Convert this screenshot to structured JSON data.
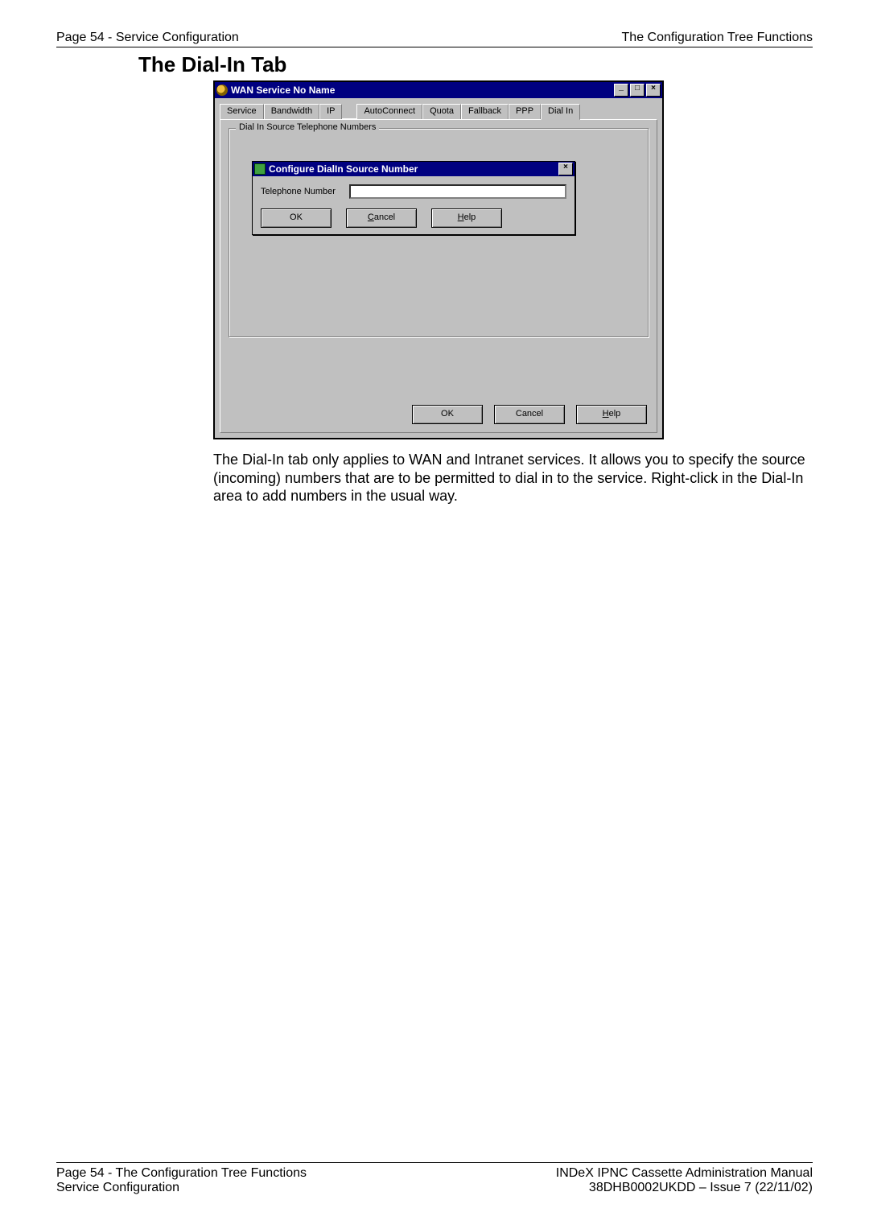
{
  "header": {
    "left": "Page 54 - Service Configuration",
    "right": "The Configuration Tree Functions"
  },
  "section_title": "The Dial-In Tab",
  "window": {
    "title": "WAN Service No Name",
    "tabs": {
      "t0": "Service",
      "t1": "Bandwidth",
      "t2": "IP",
      "t3": "AutoConnect",
      "t4": "Quota",
      "t5": "Fallback",
      "t6": "PPP",
      "t7": "Dial In"
    },
    "groupbox_legend": "Dial In Source Telephone Numbers",
    "buttons": {
      "ok": "OK",
      "cancel": "Cancel",
      "help_h": "H",
      "help_rest": "elp"
    }
  },
  "popup": {
    "title": "Configure DialIn Source Number",
    "field_label": "Telephone Number",
    "field_value": "",
    "buttons": {
      "ok": "OK",
      "cancel_c": "C",
      "cancel_rest": "ancel",
      "help_h": "H",
      "help_rest": "elp"
    }
  },
  "body_text": "The Dial-In tab only applies to WAN and Intranet services. It allows you to specify the source (incoming) numbers that are to be permitted to dial in to the service. Right-click in the Dial-In area to add numbers in the usual way.",
  "footer": {
    "left1": "Page 54 - The Configuration Tree Functions",
    "left2": "Service Configuration",
    "right1": "INDeX IPNC Cassette Administration Manual",
    "right2": "38DHB0002UKDD – Issue 7 (22/11/02)"
  }
}
